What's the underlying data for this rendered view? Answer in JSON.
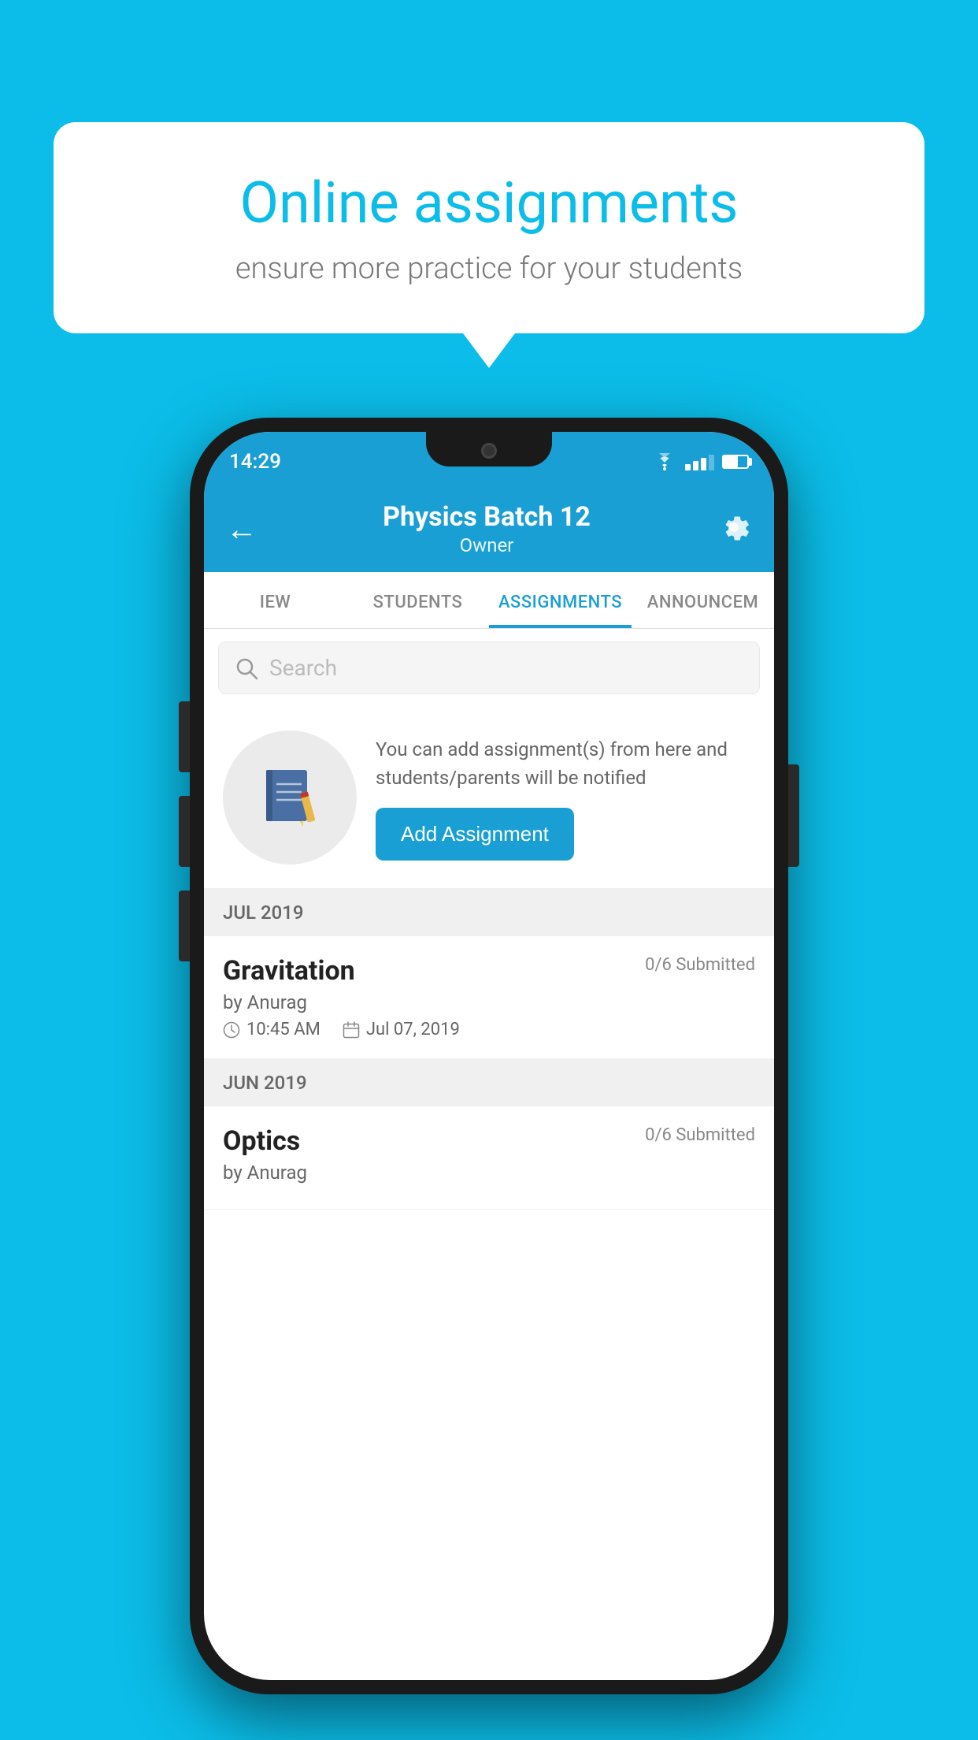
{
  "background_color": "#0bbde8",
  "speech_bubble": {
    "title": "Online assignments",
    "subtitle": "ensure more practice for your students"
  },
  "phone": {
    "status_bar": {
      "time": "14:29"
    },
    "header": {
      "title": "Physics Batch 12",
      "subtitle": "Owner",
      "back_label": "←",
      "settings_label": "⚙"
    },
    "tabs": [
      {
        "label": "IEW",
        "active": false
      },
      {
        "label": "STUDENTS",
        "active": false
      },
      {
        "label": "ASSIGNMENTS",
        "active": true
      },
      {
        "label": "ANNOUNCEM",
        "active": false
      }
    ],
    "search": {
      "placeholder": "Search"
    },
    "promo": {
      "text": "You can add assignment(s) from here and students/parents will be notified",
      "button_label": "Add Assignment"
    },
    "sections": [
      {
        "label": "JUL 2019",
        "assignments": [
          {
            "name": "Gravitation",
            "submitted": "0/6 Submitted",
            "by": "by Anurag",
            "time": "10:45 AM",
            "date": "Jul 07, 2019"
          }
        ]
      },
      {
        "label": "JUN 2019",
        "assignments": [
          {
            "name": "Optics",
            "submitted": "0/6 Submitted",
            "by": "by Anurag",
            "time": "",
            "date": ""
          }
        ]
      }
    ]
  }
}
